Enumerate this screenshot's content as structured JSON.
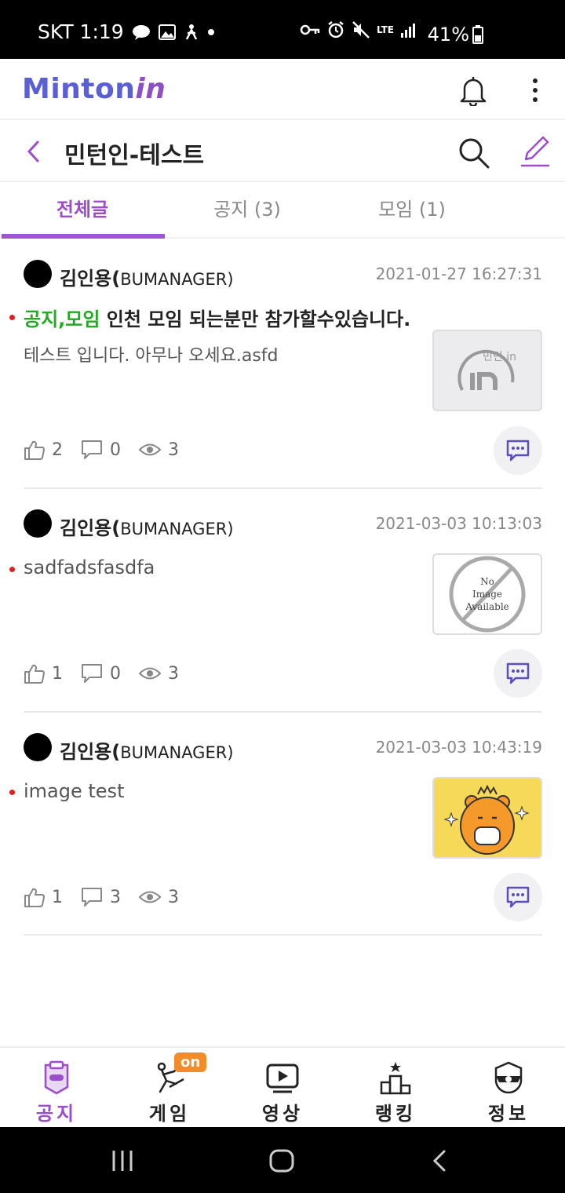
{
  "status_bar": {
    "carrier_time": "SKT 1:19",
    "network": "LTE",
    "battery": "41%",
    "icons": [
      "talk-icon",
      "gallery-icon",
      "accessibility-icon",
      "dot-icon",
      "key-icon",
      "alarm-icon",
      "mute-icon",
      "signal-icon",
      "battery-icon"
    ]
  },
  "app": {
    "logo_main": "Minton",
    "logo_suffix": "in",
    "brand_color": "#8e4fc6"
  },
  "board": {
    "title": "민턴인-테스트"
  },
  "tabs": [
    {
      "label": "전체글",
      "active": true
    },
    {
      "label": "공지 (3)",
      "active": false
    },
    {
      "label": "모임 (1)",
      "active": false
    }
  ],
  "posts": [
    {
      "author_name": "김인용(",
      "author_role": "BUMANAGER)",
      "date": "2021-01-27 16:27:31",
      "tag": "공지,모임",
      "title": " 인천 모임 되는분만 참가할수있습니다.",
      "body": "테스트 입니다. 아무나 오세요.asfd",
      "thumb_text": "민턴 in",
      "likes": "2",
      "comments": "0",
      "views": "3"
    },
    {
      "author_name": "김인용(",
      "author_role": "BUMANAGER)",
      "date": "2021-03-03 10:13:03",
      "title": "sadfadsfasdfa",
      "thumb_text_1": "No",
      "thumb_text_2": "Image",
      "thumb_text_3": "Available",
      "likes": "1",
      "comments": "0",
      "views": "3"
    },
    {
      "author_name": "김인용(",
      "author_role": "BUMANAGER)",
      "date": "2021-03-03 10:43:19",
      "title": "image test",
      "likes": "1",
      "comments": "3",
      "views": "3"
    }
  ],
  "bottom_nav": [
    {
      "label": "공지",
      "icon": "notice-icon",
      "active": true
    },
    {
      "label": "게임",
      "icon": "game-icon",
      "badge": "on"
    },
    {
      "label": "영상",
      "icon": "video-icon"
    },
    {
      "label": "랭킹",
      "icon": "ranking-icon"
    },
    {
      "label": "정보",
      "icon": "info-icon"
    }
  ],
  "colors": {
    "accent": "#9b4dca",
    "tag_green": "#22aa22",
    "badge_orange": "#f28c28",
    "dot_red": "#e02020"
  }
}
